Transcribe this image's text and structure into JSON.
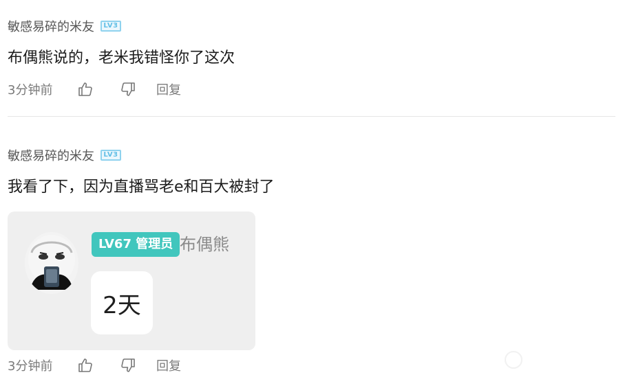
{
  "comments": [
    {
      "username": "敏感易碎的米友",
      "level_badge": "LV3",
      "text": "布偶熊说的，老米我错怪你了这次",
      "time": "3分钟前",
      "reply_label": "回复"
    },
    {
      "username": "敏感易碎的米友",
      "level_badge": "LV3",
      "text": "我看了下，因为直播骂老e和百大被封了",
      "time": "3分钟前",
      "reply_label": "回复",
      "quote": {
        "admin_badge": "LV67 管理员",
        "name": "布偶熊",
        "message": "2天"
      }
    }
  ],
  "colors": {
    "admin_badge": "#41c6bd",
    "level_badge": "#62bfe6",
    "muted_text": "#7a7a7a"
  },
  "icons": [
    "thumbs-up-icon",
    "thumbs-down-icon"
  ]
}
